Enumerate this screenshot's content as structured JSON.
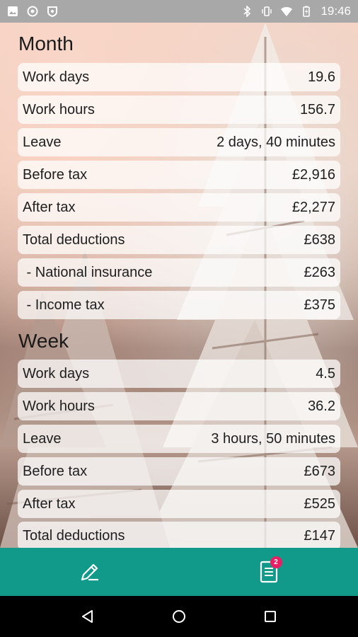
{
  "status_bar": {
    "time": "19:46",
    "left_icons": [
      "image-icon",
      "record-icon",
      "shield-icon"
    ],
    "right_icons": [
      "bluetooth-icon",
      "vibrate-icon",
      "wifi-icon",
      "battery-icon"
    ]
  },
  "month": {
    "title": "Month",
    "rows": [
      {
        "label": "Work days",
        "value": "19.6"
      },
      {
        "label": "Work hours",
        "value": "156.7"
      },
      {
        "label": "Leave",
        "value": "2 days, 40 minutes"
      },
      {
        "label": "Before tax",
        "value": "£2,916"
      },
      {
        "label": "After tax",
        "value": "£2,277"
      },
      {
        "label": "Total deductions",
        "value": "£638"
      },
      {
        "label": " - National insurance",
        "value": "£263"
      },
      {
        "label": " - Income tax",
        "value": "£375"
      }
    ]
  },
  "week": {
    "title": "Week",
    "rows": [
      {
        "label": "Work days",
        "value": "4.5"
      },
      {
        "label": "Work hours",
        "value": "36.2"
      },
      {
        "label": "Leave",
        "value": "3 hours, 50 minutes"
      },
      {
        "label": "Before tax",
        "value": "£673"
      },
      {
        "label": "After tax",
        "value": "£525"
      },
      {
        "label": "Total deductions",
        "value": "£147"
      }
    ]
  },
  "bottom_bar": {
    "edit_icon": "pencil-icon",
    "summary_icon": "document-icon",
    "summary_badge": "2",
    "color": "#119a8a"
  },
  "nav_bar": {
    "back_icon": "back-triangle-icon",
    "home_icon": "home-circle-icon",
    "recents_icon": "recents-square-icon"
  }
}
